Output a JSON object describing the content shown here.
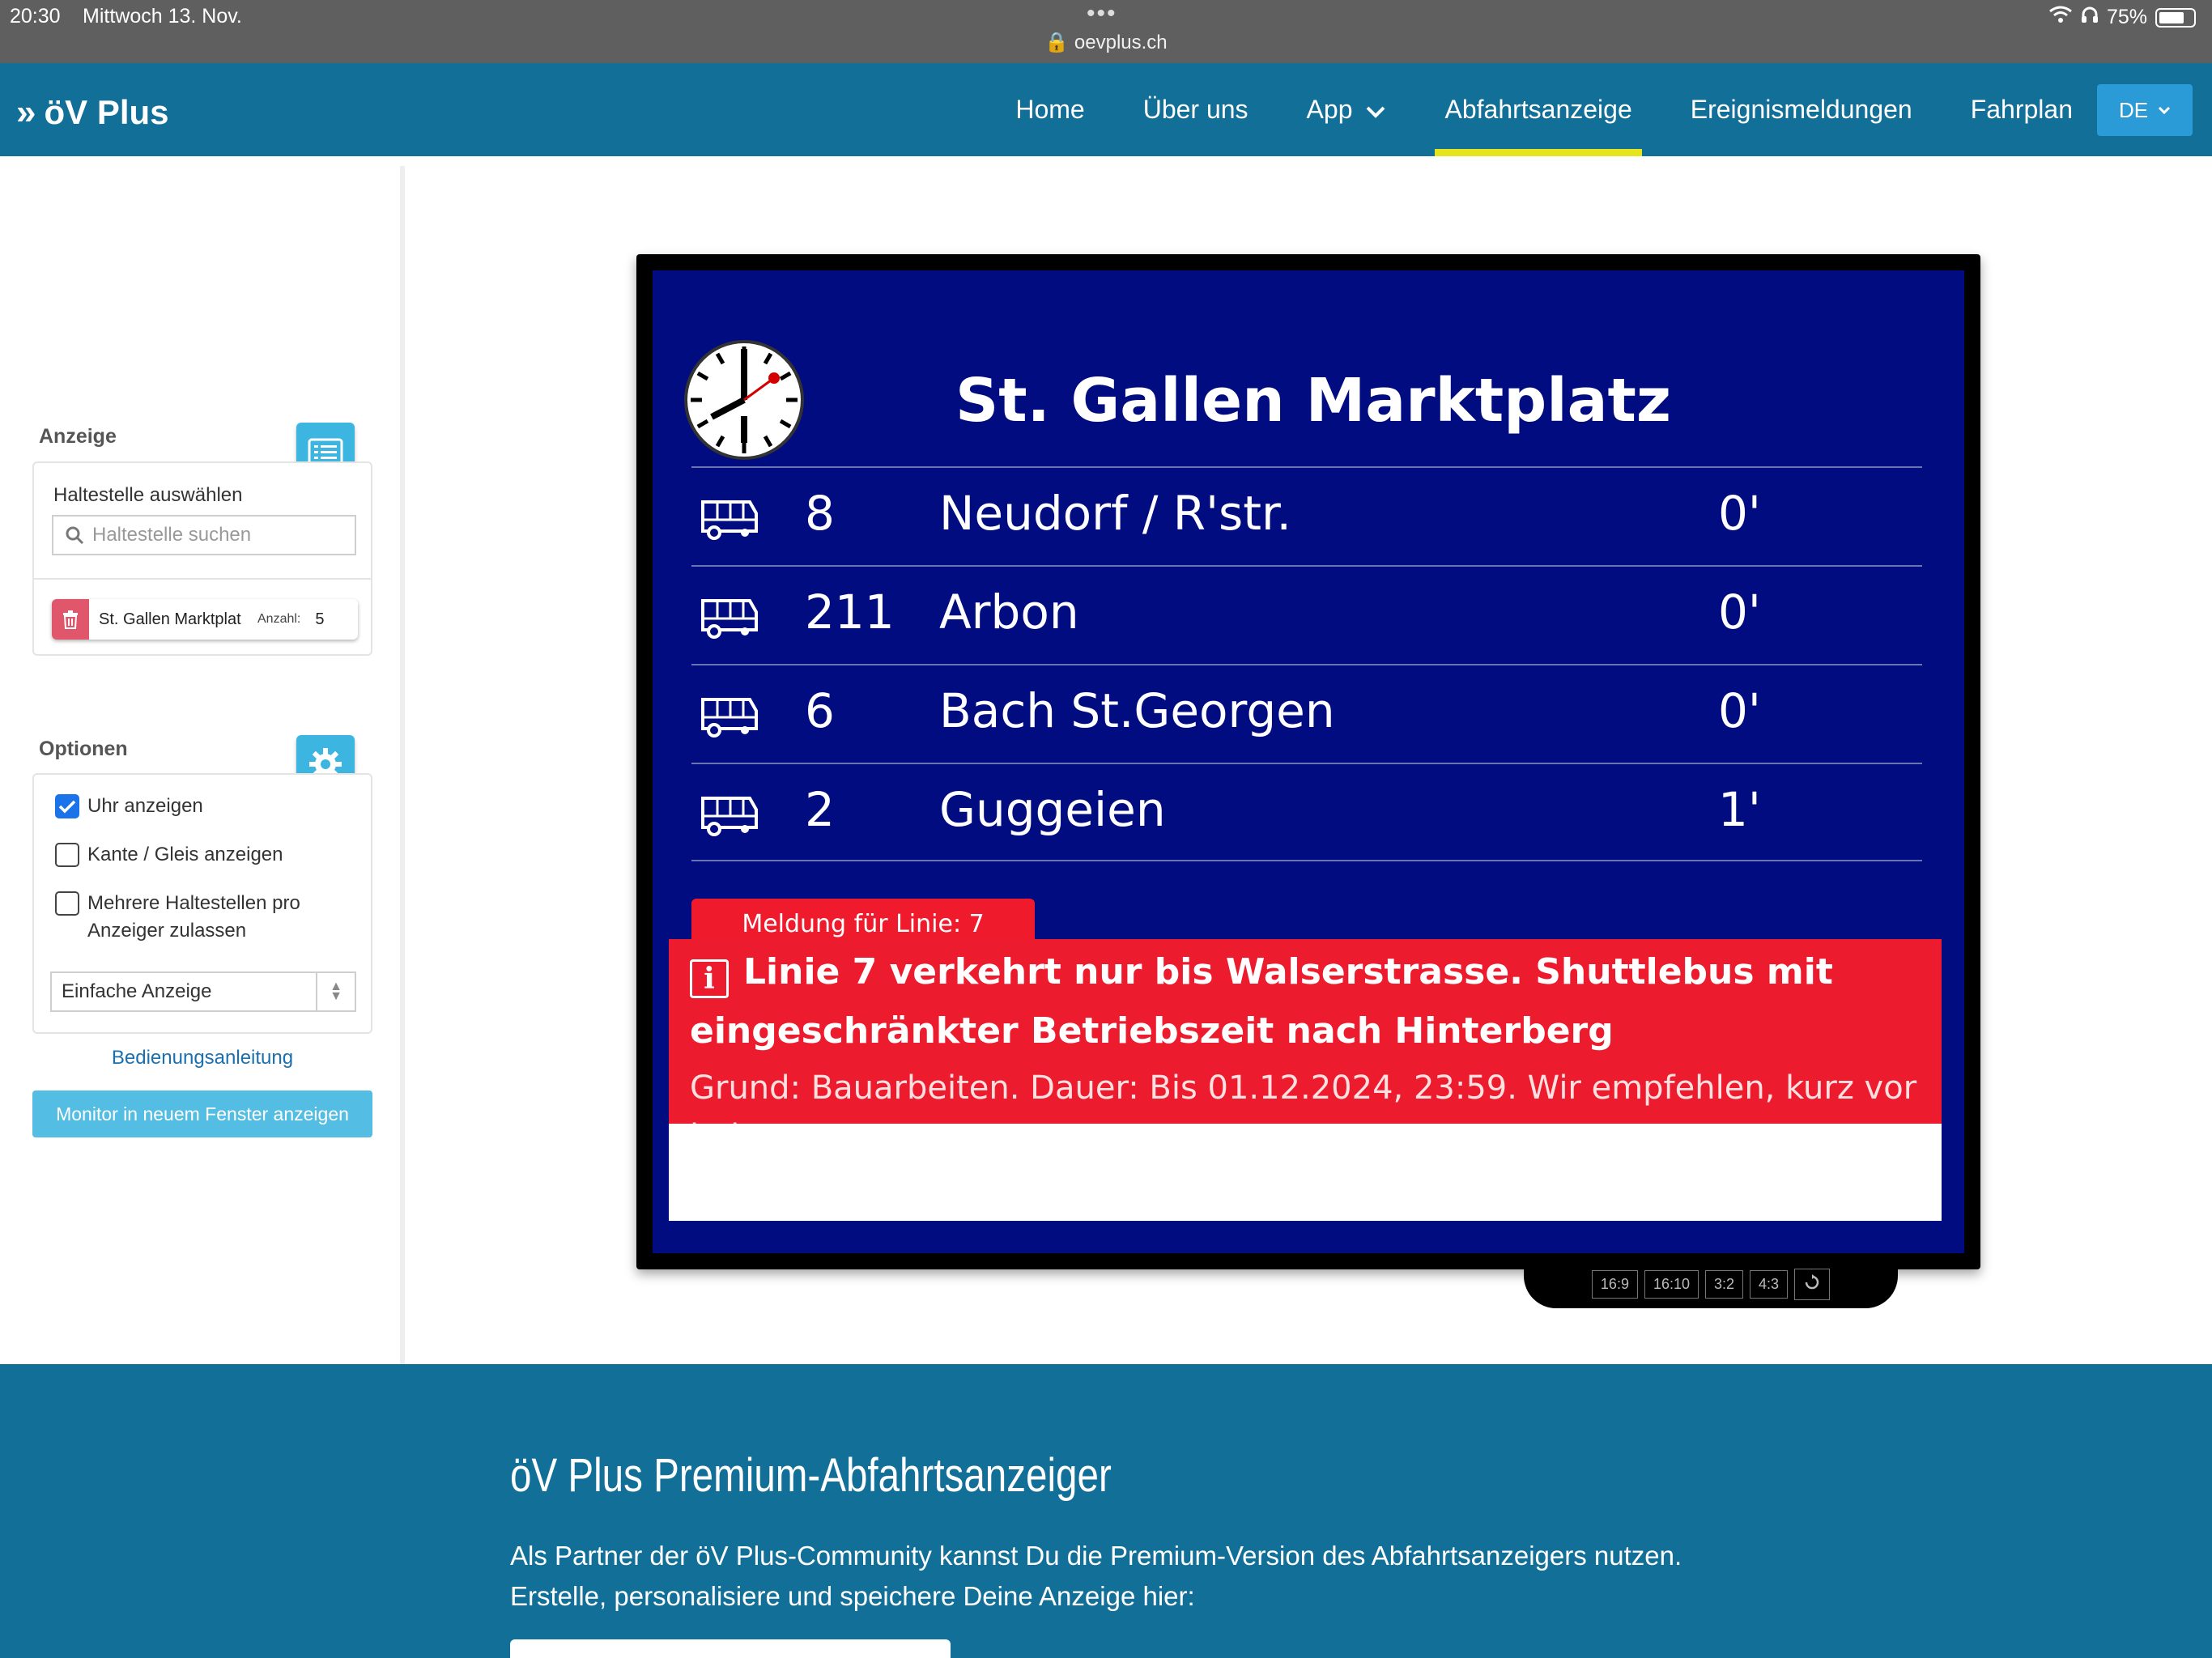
{
  "statusbar": {
    "time": "20:30",
    "date": "Mittwoch 13. Nov.",
    "url": "oevplus.ch",
    "battery": "75%"
  },
  "navbar": {
    "logo": "öV Plus",
    "links": [
      "Home",
      "Über uns",
      "App",
      "Abfahrtsanzeige",
      "Ereignismeldungen",
      "Fahrplan"
    ],
    "active": "Abfahrtsanzeige",
    "lang": "DE"
  },
  "sidebar": {
    "anzeige_title": "Anzeige",
    "select_stop_label": "Haltestelle auswählen",
    "search_placeholder": "Haltestelle suchen",
    "stop_item": {
      "name": "St. Gallen Marktplat",
      "count_label": "Anzahl:",
      "count": "5"
    },
    "options_title": "Optionen",
    "options": [
      {
        "label": "Uhr anzeigen",
        "checked": true
      },
      {
        "label": "Kante / Gleis anzeigen",
        "checked": false
      },
      {
        "label": "Mehrere Haltestellen pro Anzeiger zulassen",
        "checked": false
      }
    ],
    "display_mode": "Einfache Anzeige",
    "manual_link": "Bedienungsanleitung",
    "monitor_button": "Monitor in neuem Fenster anzeigen"
  },
  "board": {
    "station": "St. Gallen Marktplatz",
    "departures": [
      {
        "line": "8",
        "destination": "Neudorf / R'str.",
        "minutes": "0'"
      },
      {
        "line": "211",
        "destination": "Arbon",
        "minutes": "0'"
      },
      {
        "line": "6",
        "destination": "Bach St.Georgen",
        "minutes": "0'"
      },
      {
        "line": "2",
        "destination": "Guggeien",
        "minutes": "1'"
      }
    ],
    "message_tab": "Meldung für Linie: 7",
    "message_head": "Linie 7 verkehrt nur bis Walserstrasse. Shuttlebus mit eingeschränkter Betriebszeit nach Hinterberg",
    "message_body": "Grund: Bauarbeiten. Dauer: Bis 01.12.2024, 23:59. Wir empfehlen, kurz vor jeder",
    "ratios": [
      "16:9",
      "16:10",
      "3:2",
      "4:3"
    ]
  },
  "footer": {
    "title": "öV Plus Premium-Abfahrtsanzeiger",
    "line1": "Als Partner der öV Plus-Community kannst Du die Premium-Version des Abfahrtsanzeigers nutzen.",
    "line2": "Erstelle, personalisiere und speichere Deine Anzeige hier:"
  }
}
